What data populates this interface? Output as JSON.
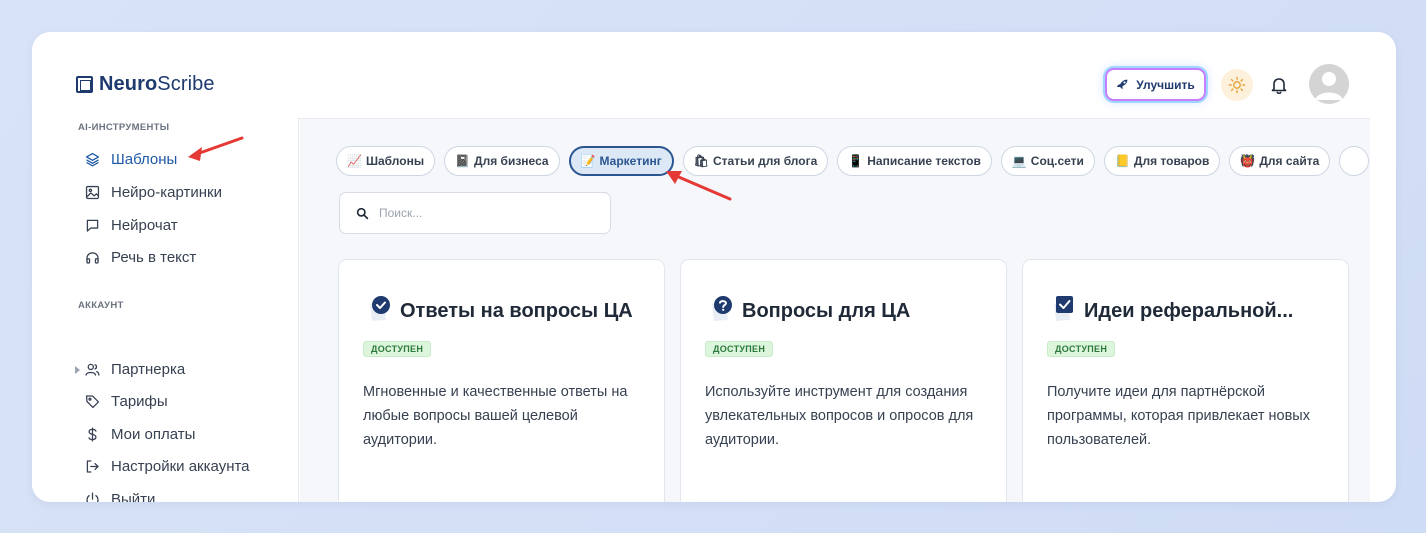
{
  "header": {
    "logo_bold": "Neuro",
    "logo_rest": "Scribe",
    "upgrade_label": "Улучшить"
  },
  "sidebar": {
    "section_tools": "AI-ИНСТРУМЕНТЫ",
    "tools": [
      {
        "label": "Шаблоны",
        "icon": "layers-icon",
        "active": true
      },
      {
        "label": "Нейро-картинки",
        "icon": "image-icon"
      },
      {
        "label": "Нейрочат",
        "icon": "chat-icon"
      },
      {
        "label": "Речь в текст",
        "icon": "headphones-icon"
      }
    ],
    "section_account": "АККАУНТ",
    "account": [
      {
        "label": "Партнерка",
        "icon": "users-icon"
      },
      {
        "label": "Тарифы",
        "icon": "tag-icon"
      },
      {
        "label": "Мои оплаты",
        "icon": "dollar-icon"
      },
      {
        "label": "Настройки аккаунта",
        "icon": "login-icon"
      },
      {
        "label": "Выйти",
        "icon": "power-icon"
      }
    ]
  },
  "chips": [
    {
      "emoji": "📈",
      "label": "Шаблоны"
    },
    {
      "emoji": "📓",
      "label": "Для бизнеса"
    },
    {
      "emoji": "📝",
      "label": "Маркетинг",
      "active": true
    },
    {
      "emoji": "🛍",
      "label": "Статьи для блога"
    },
    {
      "emoji": "📱",
      "label": "Написание текстов"
    },
    {
      "emoji": "💻",
      "label": "Соц.сети"
    },
    {
      "emoji": "📒",
      "label": "Для товаров"
    },
    {
      "emoji": "👹",
      "label": "Для сайта"
    }
  ],
  "search": {
    "placeholder": "Поиск..."
  },
  "cards": [
    {
      "title": "Ответы на вопросы ЦА",
      "icon": "check-circle-icon",
      "badge": "ДОСТУПЕН",
      "description": "Мгновенные и качественные ответы на любые вопросы вашей целевой аудитории."
    },
    {
      "title": "Вопросы для ЦА",
      "icon": "question-circle-icon",
      "badge": "ДОСТУПЕН",
      "description": "Используйте инструмент для создания увлекательных вопросов и опросов для аудитории."
    },
    {
      "title": "Идеи реферальной...",
      "icon": "checkbox-icon",
      "badge": "ДОСТУПЕН",
      "description": "Получите идеи для партнёрской программы, которая привлекает новых пользователей."
    }
  ],
  "colors": {
    "brand": "#1e3a6e",
    "active_link": "#1e5aa6",
    "badge_bg": "#dcf5dc",
    "badge_text": "#2c7a3a",
    "annotation_arrow": "#e53935"
  }
}
